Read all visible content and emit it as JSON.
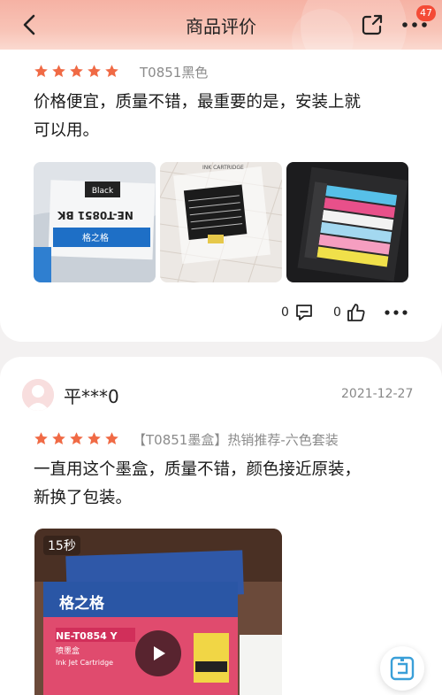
{
  "header": {
    "title": "商品评价",
    "badge_count": "47",
    "back_icon": "chevron-left-icon",
    "share_icon": "share-icon",
    "more_icon": "more-dots-icon"
  },
  "reviews": [
    {
      "rating": 5,
      "variant": "T0851黑色",
      "text_lines": [
        "价格便宜，质量不错，最重要的是，安装上就",
        "可以用。"
      ],
      "comments": "0",
      "likes": "0"
    },
    {
      "username": "平***0",
      "date": "2021-12-27",
      "rating": 5,
      "variant": "【T0851墨盒】热销推荐-六色套装",
      "text_lines": [
        "一直用这个墨盒，质量不错，颜色接近原装，",
        "新换了包装。"
      ],
      "video_duration": "15秒"
    }
  ],
  "colors": {
    "star": "#f06a45",
    "badge": "#f44b36",
    "accent_float": "#3a9fd8"
  }
}
